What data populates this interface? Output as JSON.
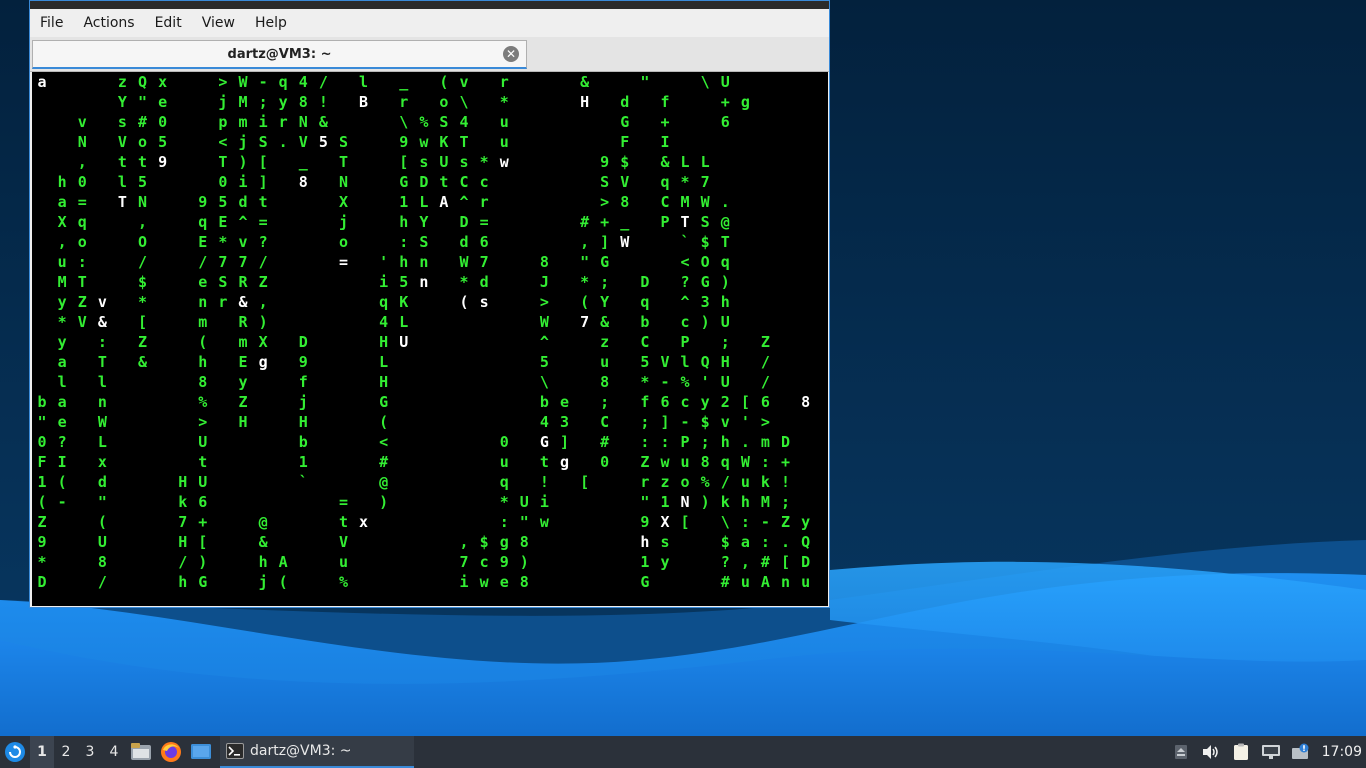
{
  "window": {
    "menu": [
      "File",
      "Actions",
      "Edit",
      "View",
      "Help"
    ],
    "tab_title": "dartz@VM3: ~",
    "tab_close_glyph": "✕"
  },
  "terminal": {
    "text_color": "#33ee33",
    "highlight_color": "#ffffff",
    "rows": [
      "a   zQx  >W-q4/ l _ (v r   &  \"  \\U",
      "    Y\"e  jM;y8! B r o\\ *   H d f  +g",
      "  v s#0  pmirN&   \\%S4 u     G +  6 ",
      "  N Vo5  <jS.V5S  9wKT u     F I    ",
      "  , tt9  T)[ _ T  [sUs*w    9$ &LL  ",
      " h0 l5   0i] 8 N  GDtCc     SV q*7  ",
      " a= TN  95dt   X  1LA^r     >8 CMW. ",
      " Xq  ,  qE^=   j  hY D=    #+_ PTS@ ",
      " ,o  O  E*v?   o  :S d6    ,]W  `$T ",
      " u:  /  /77/   = 'hn W7  8 \"G   <Oq ",
      " MT  $  eSRZ     i5n *d  J *; D ?G) ",
      " yZv *  nr&,     qK  (s  > (Y q ^3h ",
      " *V& [  m R)     4L      W 7& b c)U ",
      " y : Z  ( mX D   HU      ^  z C P ; Z",
      " a T &  h Eg 9   L       5  u 5VlQH /",
      " l l    8 y  f   H       \\  8 *-%'U /",
      "ba n    % Z  j   G       be ; f6cy2[6 8",
      "\"e W    > H  H   (       43 C ;]-$v'> ",
      "0? L    U    b   <     0 G] # ::P;h.mD",
      "FI x    t    1   #     u tg 0 Zwu8qW:+",
      "1( d   HU    `   @     q ! [  rzo%/uk!",
      "(- \"   k6      = )     *Ui    \"1N)khM;",
      "Z  (   7+  @   tx      :\"w    9X[ \\:-Zy",
      "9  U   H[  &   V     ,$g8     hs  $a:.Q",
      "*  8   /)  hA  u     7c9)     1y  ?,#[D",
      "D  /   hG  j(  %     iwe8     G   #uAnu"
    ],
    "white_chars": [
      [
        0,
        0
      ],
      [
        1,
        16
      ],
      [
        1,
        27
      ],
      [
        1,
        36
      ],
      [
        2,
        35
      ],
      [
        3,
        14
      ],
      [
        4,
        6
      ],
      [
        4,
        23
      ],
      [
        5,
        13
      ],
      [
        6,
        4
      ],
      [
        6,
        20
      ],
      [
        7,
        32
      ],
      [
        8,
        29
      ],
      [
        9,
        15
      ],
      [
        10,
        19
      ],
      [
        11,
        3
      ],
      [
        11,
        10
      ],
      [
        11,
        21
      ],
      [
        11,
        22
      ],
      [
        12,
        27
      ],
      [
        12,
        3
      ],
      [
        13,
        18
      ],
      [
        14,
        11
      ],
      [
        16,
        38
      ],
      [
        18,
        25
      ],
      [
        19,
        26
      ],
      [
        20,
        28
      ],
      [
        21,
        32
      ],
      [
        21,
        19
      ],
      [
        22,
        16
      ],
      [
        22,
        31
      ],
      [
        23,
        30
      ],
      [
        24,
        29
      ]
    ]
  },
  "taskbar": {
    "workspaces": [
      "1",
      "2",
      "3",
      "4"
    ],
    "active_workspace": "1",
    "task_label": "dartz@VM3: ~",
    "clock": "17:09",
    "accent": "#3a8ad8"
  }
}
